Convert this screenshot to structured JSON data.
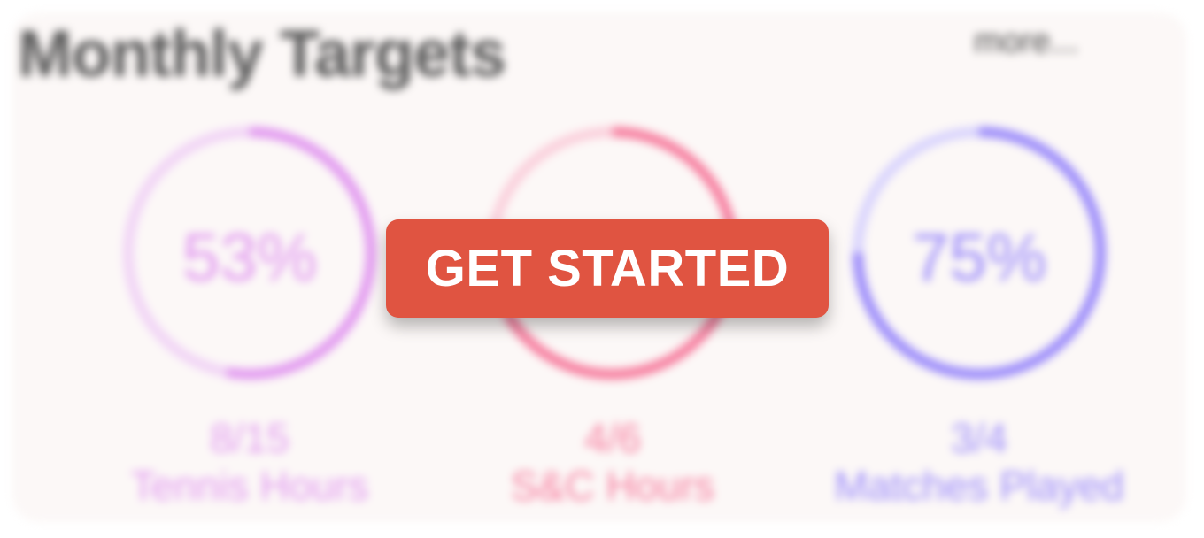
{
  "card": {
    "title": "Monthly Targets",
    "more_label": "more..."
  },
  "targets": [
    {
      "percent_label": "53%",
      "count": "8/15",
      "label": "Tennis Hours",
      "progress": 0.53,
      "color": "#e29af0",
      "track_color": "#f1d4f6"
    },
    {
      "percent_label": "",
      "count": "4/6",
      "label": "S&C Hours",
      "progress": 0.667,
      "color": "#f77fa0",
      "track_color": "#fbd0dc"
    },
    {
      "percent_label": "75%",
      "count": "3/4",
      "label": "Matches Played",
      "progress": 0.75,
      "color": "#9c8cfb",
      "track_color": "#d9d4fd"
    }
  ],
  "cta": {
    "label": "GET STARTED",
    "color": "#e05441"
  }
}
